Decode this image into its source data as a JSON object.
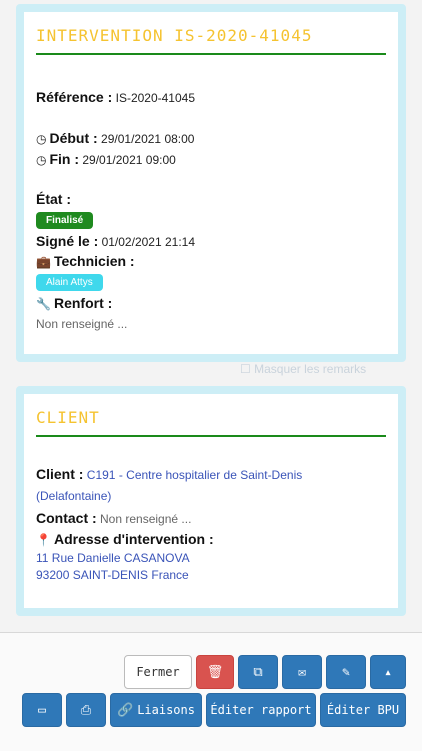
{
  "background": {
    "ghost_checkbox_label": "Masquer les remarks"
  },
  "intervention_card": {
    "title": "INTERVENTION IS-2020-41045",
    "reference_label": "Référence :",
    "reference_value": "IS-2020-41045",
    "debut_label": "Début :",
    "debut_value": "29/01/2021 08:00",
    "fin_label": "Fin :",
    "fin_value": "29/01/2021 09:00",
    "etat_label": "État :",
    "etat_badge": "Finalisé",
    "signe_label": "Signé le :",
    "signe_value": "01/02/2021 21:14",
    "technicien_label": "Technicien :",
    "technicien_badge": "Alain Attys",
    "renfort_label": "Renfort :",
    "renfort_value": "Non renseigné ..."
  },
  "client_card": {
    "title": "CLIENT",
    "client_label": "Client :",
    "client_value_line1": "C191 - Centre hospitalier de Saint-Denis",
    "client_value_line2": "(Delafontaine)",
    "contact_label": "Contact :",
    "contact_value": "Non renseigné ...",
    "adresse_label": "Adresse d'intervention :",
    "adresse_line1": "11 Rue Danielle CASANOVA",
    "adresse_line2": "93200 SAINT-DENIS France"
  },
  "toolbar": {
    "fermer_label": "Fermer",
    "liaisons_label": "Liaisons",
    "editer_rapport_label": "Éditer rapport",
    "editer_bpu_label": "Éditer BPU"
  },
  "colors": {
    "accent_title": "#f5c330",
    "divider": "#1a8a1a",
    "badge_finalise": "#1f8a1f",
    "badge_technicien": "#3fd8ec",
    "button_primary": "#2f78b8",
    "button_danger": "#d9534f"
  },
  "icons": {
    "debut": "clock-icon",
    "fin": "clock-icon",
    "technicien": "briefcase-icon",
    "renfort": "wrench-icon",
    "adresse": "map-marker-icon",
    "delete": "trash-icon",
    "duplicate": "copy-icon",
    "email": "envelope-icon",
    "edit": "pencil-icon",
    "collapse": "caret-up-icon",
    "window": "window-icon",
    "print": "print-icon",
    "liaisons": "link-icon"
  }
}
